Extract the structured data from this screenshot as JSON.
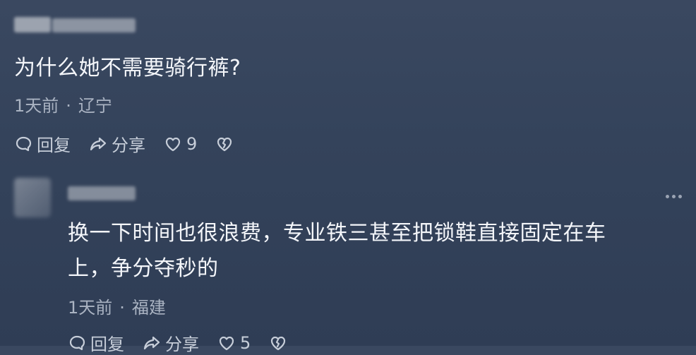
{
  "comment1": {
    "username_blurred": "",
    "text": "为什么她不需要骑行裤?",
    "time": "1天前",
    "location": "辽宁",
    "reply_label": "回复",
    "share_label": "分享",
    "like_count": "9"
  },
  "comment2": {
    "username_blurred": "",
    "text_line1": "换一下时间也很浪费，专业铁三甚至把锁鞋直接固定在车",
    "text_line2": "上，争分夺秒的",
    "time": "1天前",
    "location": "福建",
    "reply_label": "回复",
    "share_label": "分享",
    "like_count": "5"
  },
  "icons": {
    "reply": "comment-bubble-icon",
    "share": "share-arrow-icon",
    "like": "heart-icon",
    "dislike": "broken-heart-icon",
    "more": "more-dots-icon"
  }
}
